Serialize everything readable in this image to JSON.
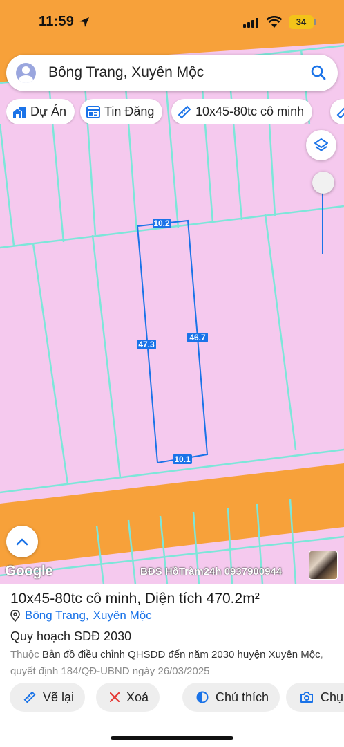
{
  "status_bar": {
    "time": "11:59",
    "battery": "34"
  },
  "search": {
    "query": "Bông Trang, Xuyên Mộc"
  },
  "chips": [
    {
      "label": "Dự Án",
      "icon": "house-icon"
    },
    {
      "label": "Tin Đăng",
      "icon": "listing-icon"
    },
    {
      "label": "10x45-80tc cô minh",
      "icon": "ruler-icon"
    }
  ],
  "map": {
    "colors": {
      "residential": "#f5c9ee",
      "road": "#f7a13a",
      "parcel_line": "#7de6d9",
      "measurement": "#1a73e8"
    },
    "measurements": {
      "top": "10.2",
      "left": "47.3",
      "right": "46.7",
      "bottom": "10.1"
    },
    "attribution": "Google",
    "watermark": "BĐS HồTràm24h 0937900944"
  },
  "sheet": {
    "title": "10x45-80tc cô minh, Diện tích 470.2m²",
    "address_parts": [
      "Bông Trang",
      "Xuyên Mộc"
    ],
    "plan": "Quy hoạch SDĐ 2030",
    "desc_prefix": "Thuộc ",
    "desc_map": "Bản đồ điều chỉnh QHSDĐ đến năm 2030 huyện Xuyên Mộc",
    "desc_suffix": ", quyết định 184/QĐ-UBND ngày 26/03/2025"
  },
  "actions": [
    {
      "label": "Vẽ lại",
      "icon": "redraw-icon"
    },
    {
      "label": "Xoá",
      "icon": "close-icon"
    },
    {
      "label": "Chú thích",
      "icon": "legend-icon"
    },
    {
      "label": "Chụp",
      "icon": "camera-icon"
    }
  ]
}
